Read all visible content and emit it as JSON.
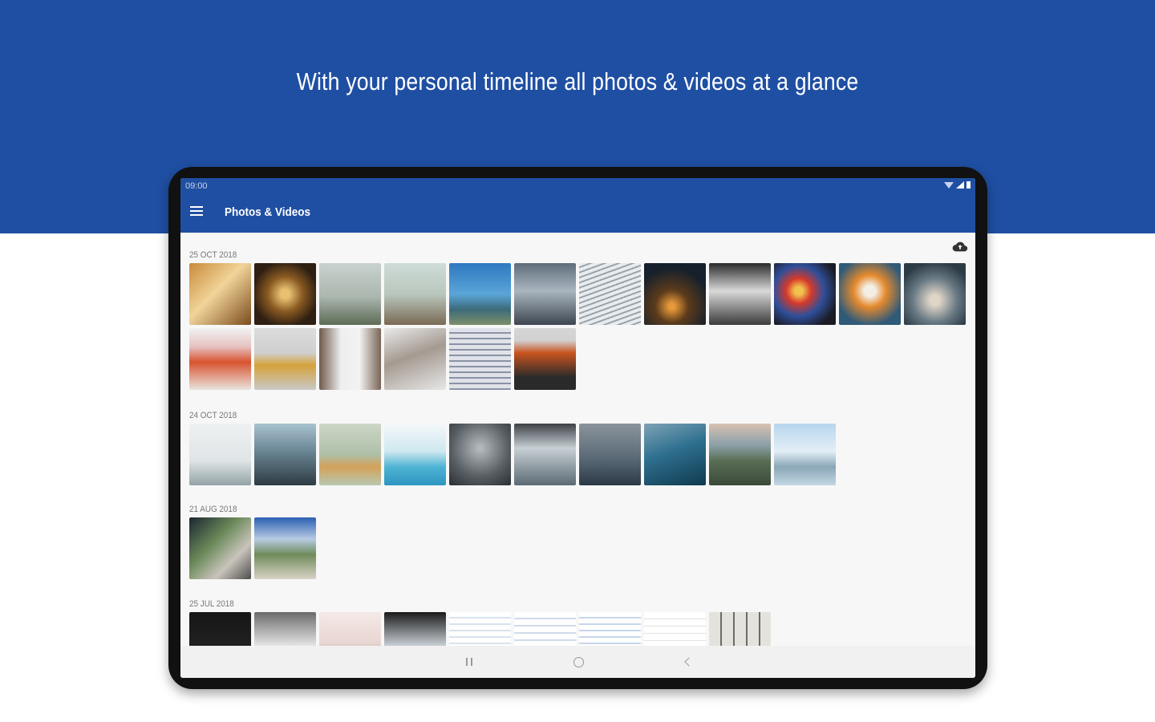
{
  "headline": "With your personal timeline all photos & videos at a glance",
  "status_bar": {
    "time": "09:00"
  },
  "app_bar": {
    "title": "Photos & Videos",
    "menu_icon": "menu-icon"
  },
  "cloud_icon": "cloud-upload-icon",
  "colors": {
    "brand_blue": "#1f4fa2",
    "screen_bg": "#f7f7f7"
  },
  "sections": [
    {
      "date": "25 OCT 2018",
      "thumbs": [
        {
          "bg": "linear-gradient(135deg,#c98b3a,#f1d49a 45%,#7a4b1c)"
        },
        {
          "bg": "radial-gradient(circle at 50% 50%,#e7c071 10%,#8a5a22 40%,#2e1f12 75%)"
        },
        {
          "bg": "linear-gradient(180deg,#c9d2cf,#aab6ae 55%,#5d6b55)"
        },
        {
          "bg": "linear-gradient(180deg,#cfdcd8,#b9c7bd 50%,#7a6a55)"
        },
        {
          "bg": "linear-gradient(180deg,#2f78c0,#5aa5d9 50%,#3d6a7a 75%,#7c8f6a)"
        },
        {
          "bg": "linear-gradient(180deg,#5f6d7a,#a9b6bf 45%,#3e4650)"
        },
        {
          "bg": "repeating-linear-gradient(160deg,#e8ecef 0 4px,#9aa3ab 4px 6px)"
        },
        {
          "bg": "radial-gradient(circle at 45% 70%,#e89a3a 5%,#5c3b1b 30%,#16202c 70%)"
        },
        {
          "bg": "linear-gradient(180deg,#2a2a2a,#d9d9d9 45%,#3b3b3b)"
        },
        {
          "bg": "radial-gradient(circle at 40% 45%,#f2c14e 8%,#d5392b 25%,#2f4f9a 50%,#1b1b24 80%)"
        },
        {
          "bg": "radial-gradient(circle at 50% 45%,#f3efe7 12%,#e58a2e 35%,#2f5a78 75%)"
        },
        {
          "bg": "radial-gradient(circle at 50% 60%,#e0d6c8 10%,#6b7c86 45%,#2c3a44 80%)"
        },
        {
          "bg": "linear-gradient(180deg,#f2f2f2,#e6c2c2 30%,#d8532e 55%,#e9e4df)"
        },
        {
          "bg": "linear-gradient(180deg,#dcdcdc,#cfcfcf 40%,#d5a23a 60%,#c9c9c9)"
        },
        {
          "bg": "linear-gradient(90deg,#6f5a4c,#eeeeee 35%,#f3f3f3 65%,#7a6455)"
        },
        {
          "bg": "linear-gradient(160deg,#eaeaea,#a49a90 45%,#e7e7e7)"
        },
        {
          "bg": "repeating-linear-gradient(180deg,#dfe2e8 0 5px,#8a93a5 5px 7px)"
        },
        {
          "bg": "linear-gradient(180deg,#d6d6d6,#d1d1d1 20%,#c9541f 40%,#2a2a2a 80%)"
        }
      ]
    },
    {
      "date": "24 OCT 2018",
      "thumbs": [
        {
          "bg": "linear-gradient(180deg,#eef1f2,#dfe4e6 60%,#93a3a8)"
        },
        {
          "bg": "linear-gradient(180deg,#a9c2cf,#6a8594 45%,#2e3b42)"
        },
        {
          "bg": "linear-gradient(180deg,#cdd7c7,#aebfa8 50%,#d3a25a 70%,#b8c8b0)"
        },
        {
          "bg": "linear-gradient(180deg,#f4f8fa,#cfe8ef 45%,#4fb4d4 70%,#2d95c0)"
        },
        {
          "bg": "radial-gradient(circle at 50% 40%,#b8bec2,#565d62 60%,#2a2e32)"
        },
        {
          "bg": "linear-gradient(180deg,#3d4146,#c7d0d5 40%,#5b6a73)"
        },
        {
          "bg": "linear-gradient(180deg,#8a939b,#5b6b77 55%,#2a3945)"
        },
        {
          "bg": "linear-gradient(160deg,#7ea3b6,#2e6f8f 45%,#0f3a4e)"
        },
        {
          "bg": "linear-gradient(180deg,#d8c2b2,#8aa0a8 35%,#5a6e55 60%,#3b4a3a)"
        },
        {
          "bg": "linear-gradient(180deg,#b7d6ee,#e3eef5 45%,#8aa7b8 70%,#c3d6e2)"
        }
      ]
    },
    {
      "date": "21 AUG 2018",
      "thumbs": [
        {
          "bg": "linear-gradient(135deg,#1b2530,#6b8a5a 40%,#c9c4bb 70%,#4d4d4d)"
        },
        {
          "bg": "linear-gradient(180deg,#2b5fb2,#b7cbe2 35%,#6f8c5b 60%,#d9d2c6)"
        }
      ]
    },
    {
      "date": "25 JUL 2018",
      "thumbs": [
        {
          "bg": "linear-gradient(180deg,#161616,#2a2a2a)"
        },
        {
          "bg": "linear-gradient(180deg,#6c6c6c,#e6e6e6 55%,#9a9a9a)"
        },
        {
          "bg": "linear-gradient(180deg,#f5e9e7,#e8d6d2 50%,#8a5a3a)"
        },
        {
          "bg": "linear-gradient(180deg,#1a1a1a,#c9d0d6 55%,#3a3a3a)"
        },
        {
          "bg": "repeating-linear-gradient(180deg,#ffffff 0 6px,#d9e3ef 6px 8px)"
        },
        {
          "bg": "repeating-linear-gradient(180deg,#ffffff 0 7px,#cfdbeb 7px 9px)"
        },
        {
          "bg": "repeating-linear-gradient(180deg,#ffffff 0 6px,#c7d6ea 6px 8px)"
        },
        {
          "bg": "repeating-linear-gradient(180deg,#ffffff 0 8px,#e1e1e1 8px 9px)"
        },
        {
          "bg": "repeating-linear-gradient(90deg,#e4e2dc 0 14px,#6b6b6b 14px 16px)"
        }
      ]
    }
  ],
  "nav_bar": {
    "recents": "recents-icon",
    "home": "home-icon",
    "back": "back-icon"
  }
}
